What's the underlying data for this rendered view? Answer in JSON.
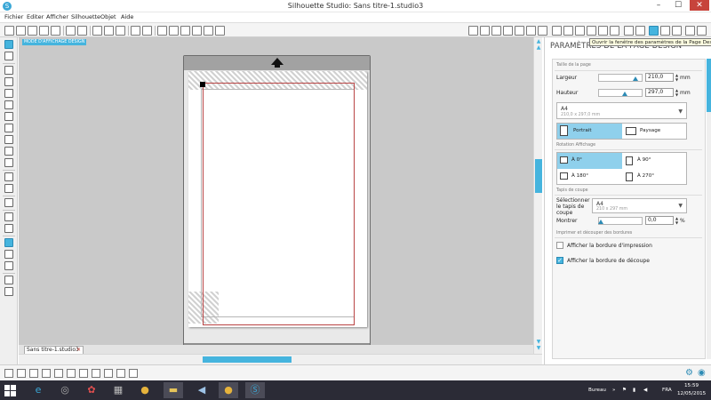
{
  "window": {
    "title": "Silhouette Studio: Sans titre-1.studio3",
    "minimize": "–",
    "maximize": "☐",
    "close": "✕"
  },
  "menu": [
    "Fichier",
    "Editer",
    "Afficher",
    "Silhouette",
    "Objet",
    "Aide"
  ],
  "tooltip": "Ouvrir la fenêtre des paramètres de la Page Design",
  "canvas": {
    "label": "MODE D'AFFICHAGE DESIGN"
  },
  "document_tab": {
    "label": "Sans titre-1.studio3",
    "close": "✕"
  },
  "panel": {
    "title": "PARAMÈTRES DE LA PAGE DESIGN",
    "page_size": {
      "section": "Taille de la page",
      "width_label": "Largeur",
      "width_value": "210,0",
      "height_label": "Hauteur",
      "height_value": "297,0",
      "unit": "mm",
      "preset": "A4",
      "preset_sub": "210,0 x 297,0 mm"
    },
    "orientation": {
      "portrait": "Portrait",
      "landscape": "Paysage",
      "selected": "portrait"
    },
    "rotation": {
      "section": "Rotation Affichage",
      "options": [
        "À 0°",
        "À 90°",
        "À 180°",
        "À 270°"
      ],
      "selected": "À 0°"
    },
    "mat": {
      "section": "Tapis de coupe",
      "select_label": "Sélectionner le tapis de coupe",
      "value": "A4",
      "value_sub": "210 x 297 mm",
      "show_label": "Montrer",
      "show_value": "0,0",
      "show_unit": "%"
    },
    "print_cut": {
      "section": "Imprimer et découper des bordures",
      "print_border_label": "Afficher la bordure d'impression",
      "print_border_checked": false,
      "cut_border_label": "Afficher la bordure de découpe",
      "cut_border_checked": true
    }
  },
  "taskbar": {
    "desktop_label": "Bureau",
    "lang": "FRA",
    "time": "15:59",
    "date": "12/05/2015"
  }
}
